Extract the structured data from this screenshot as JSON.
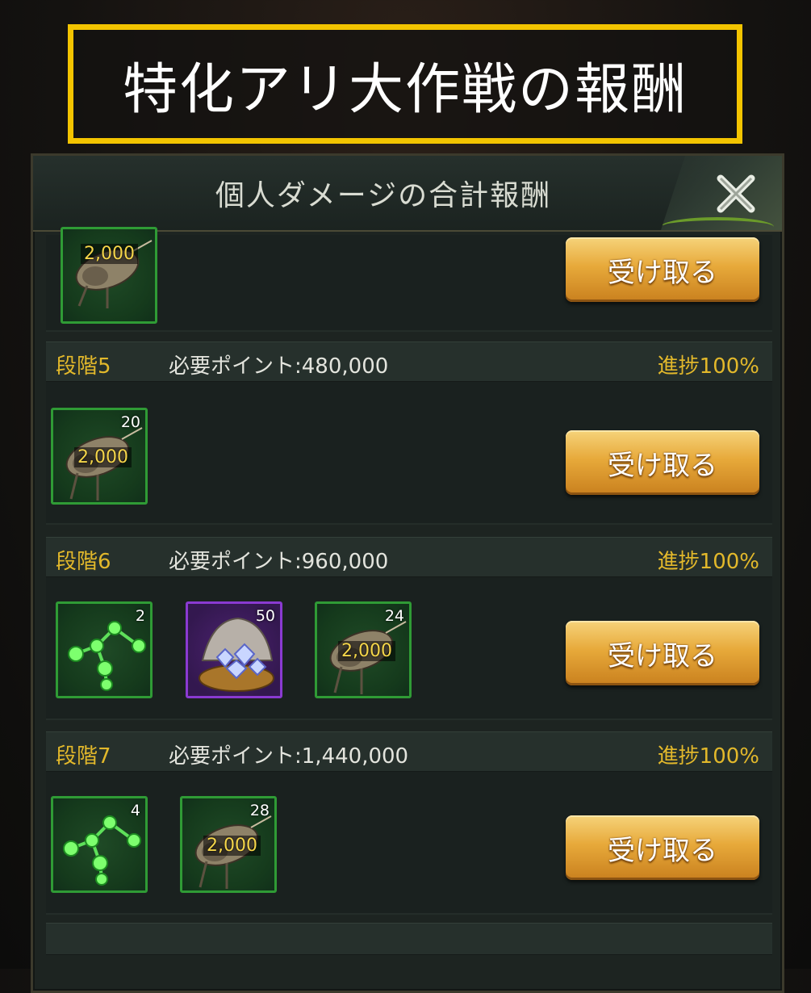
{
  "banner": {
    "title": "特化アリ大作戦の報酬"
  },
  "panel": {
    "title": "個人ダメージの合計報酬"
  },
  "claim_label": "受け取る",
  "rows": [
    {
      "items": [
        {
          "kind": "bug",
          "label": "2,000",
          "qty": ""
        }
      ]
    },
    {
      "stage": "段階5",
      "required": "必要ポイント:480,000",
      "progress": "進捗100%",
      "items": [
        {
          "kind": "bug",
          "label": "2,000",
          "qty": "20"
        }
      ]
    },
    {
      "stage": "段階6",
      "required": "必要ポイント:960,000",
      "progress": "進捗100%",
      "items": [
        {
          "kind": "molecule",
          "qty": "2"
        },
        {
          "kind": "gem-chest",
          "qty": "50"
        },
        {
          "kind": "bug",
          "label": "2,000",
          "qty": "24"
        }
      ]
    },
    {
      "stage": "段階7",
      "required": "必要ポイント:1,440,000",
      "progress": "進捗100%",
      "items": [
        {
          "kind": "molecule",
          "qty": "4"
        },
        {
          "kind": "bug",
          "label": "2,000",
          "qty": "28"
        }
      ]
    }
  ],
  "colors": {
    "gold": "#e2b82b",
    "banner_border": "#f3c400",
    "item_border": "#2f9b35",
    "rare_border": "#8a3ad1"
  }
}
